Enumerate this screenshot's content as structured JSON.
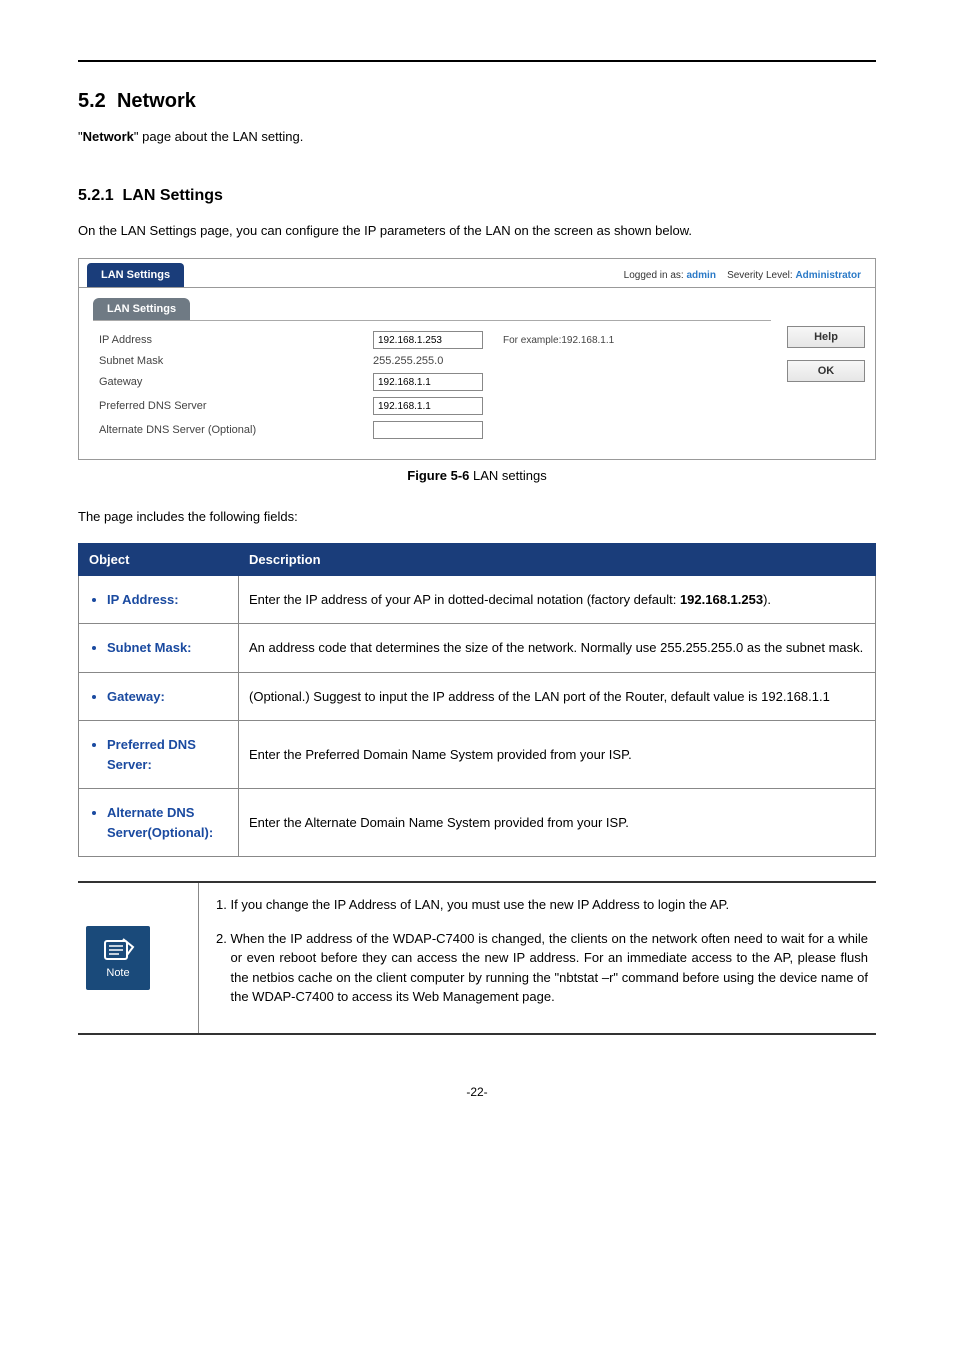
{
  "page_number_label": "-22-",
  "section": {
    "number": "5.2",
    "title": "Network",
    "intro_pre_quote": "\"",
    "intro_bold": "Network",
    "intro_post": "\" page about the LAN setting."
  },
  "subsection": {
    "number": "5.2.1",
    "title": "LAN Settings",
    "intro": "On the LAN Settings page, you can configure the IP parameters of the LAN on the screen as shown below."
  },
  "screenshot": {
    "tab": "LAN Settings",
    "logged_in_label": "Logged in as:",
    "logged_in_user": "admin",
    "severity_label": "Severity Level:",
    "severity_value": "Administrator",
    "panel_tab": "LAN Settings",
    "rows": {
      "ip_label": "IP Address",
      "ip_value": "192.168.1.253",
      "ip_hint": "For example:192.168.1.1",
      "mask_label": "Subnet Mask",
      "mask_value": "255.255.255.0",
      "gw_label": "Gateway",
      "gw_value": "192.168.1.1",
      "pdns_label": "Preferred DNS Server",
      "pdns_value": "192.168.1.1",
      "adns_label": "Alternate DNS Server (Optional)",
      "adns_value": ""
    },
    "buttons": {
      "help": "Help",
      "ok": "OK"
    }
  },
  "caption": {
    "bold": "Figure 5-6",
    "rest": " LAN settings"
  },
  "fields_intro": "The page includes the following fields:",
  "table": {
    "head_object": "Object",
    "head_desc": "Description",
    "rows": [
      {
        "object": "IP Address:",
        "desc_pre": "Enter the IP address of your AP in dotted-decimal notation (factory default: ",
        "desc_bold": "192.168.1.253",
        "desc_post": ")."
      },
      {
        "object": "Subnet Mask:",
        "desc": "An address code that determines the size of the network. Normally use 255.255.255.0 as the subnet mask."
      },
      {
        "object": "Gateway:",
        "desc": "(Optional.) Suggest to input the IP address of the LAN port of the Router, default value is 192.168.1.1"
      },
      {
        "object": "Preferred DNS Server:",
        "desc": "Enter the Preferred Domain Name System provided from your ISP."
      },
      {
        "object": "Alternate DNS Server(Optional):",
        "desc": "Enter the Alternate Domain Name System provided from your ISP."
      }
    ]
  },
  "note": {
    "label": "Note",
    "items": [
      "If you change the IP Address of LAN, you must use the new IP Address to login the AP.",
      "When the IP address of the WDAP-C7400 is changed, the clients on the network often need to wait for a while or even reboot before they can access the new IP address. For an immediate access to the AP, please flush the netbios cache on the client computer by running the \"nbtstat –r\" command before using the device name of the WDAP-C7400 to access its Web Management page."
    ]
  }
}
